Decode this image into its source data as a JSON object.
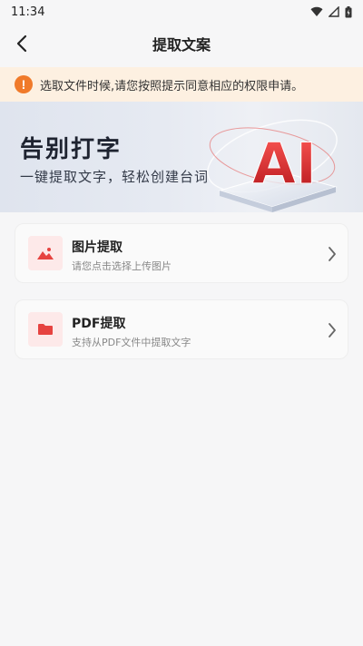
{
  "status_bar": {
    "time": "11:34"
  },
  "nav": {
    "title": "提取文案"
  },
  "notice": {
    "icon_text": "!",
    "text": "选取文件时候,请您按照提示同意相应的权限申请。"
  },
  "banner": {
    "title": "告别打字",
    "subtitle": "一键提取文字，轻松创建台词",
    "art_text": "AI"
  },
  "options": [
    {
      "title": "图片提取",
      "description": "请您点击选择上传图片",
      "icon": "image-icon"
    },
    {
      "title": "PDF提取",
      "description": "支持从PDF文件中提取文字",
      "icon": "folder-icon"
    }
  ],
  "colors": {
    "accent_red": "#e64340",
    "notice_bg": "#fdf0e1",
    "notice_icon": "#f07a2a",
    "icon_bg": "#fde9e9"
  }
}
